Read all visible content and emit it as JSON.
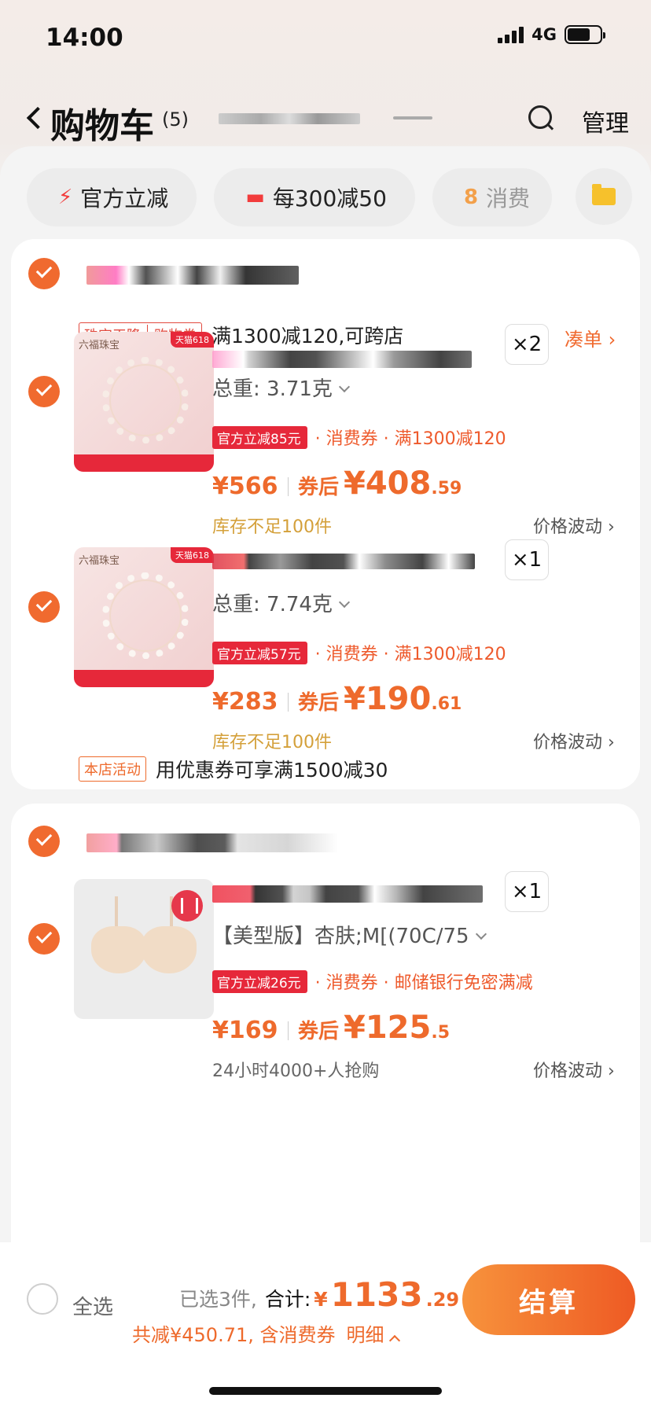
{
  "status": {
    "time": "14:00",
    "network": "4G"
  },
  "nav": {
    "title": "购物车",
    "count": "(5)",
    "manage": "管理"
  },
  "filters": [
    {
      "icon": "⚡",
      "label": "官方立减"
    },
    {
      "icon": "▬",
      "label": "每300减50"
    },
    {
      "icon": "8",
      "label": "消费"
    }
  ],
  "store1": {
    "promo_tag_a": "珠宝天降",
    "promo_tag_b": "购物券",
    "promo_text": "满1300减120,可跨店",
    "promo_link": "凑单 ›",
    "items": [
      {
        "qty": "×2",
        "thumb_brand": "六福珠宝",
        "thumb_badge": "天猫618",
        "spec": "总重: 3.71克",
        "deal_tag": "官方立减85元",
        "deal_text": "· 消费券 · 满1300减120",
        "price": "¥566",
        "after_label": "券后",
        "after_big": "¥408",
        "after_small": ".59",
        "note": "库存不足100件",
        "fluct": "价格波动 ›"
      },
      {
        "qty": "×1",
        "thumb_brand": "六福珠宝",
        "thumb_badge": "天猫618",
        "spec": "总重: 7.74克",
        "deal_tag": "官方立减57元",
        "deal_text": "· 消费券 · 满1300减120",
        "price": "¥283",
        "after_label": "券后",
        "after_big": "¥190",
        "after_small": ".61",
        "note": "库存不足100件",
        "fluct": "价格波动 ›"
      }
    ],
    "activity_tag": "本店活动",
    "activity_text": "用优惠券可享满1500减30"
  },
  "store2": {
    "items": [
      {
        "qty": "×1",
        "spec": "【美型版】杏肤;M[(70C/75",
        "deal_tag": "官方立减26元",
        "deal_text": "· 消费券 · 邮储银行免密满减",
        "price": "¥169",
        "after_label": "券后",
        "after_big": "¥125",
        "after_small": ".5",
        "note": "24小时4000+人抢购",
        "fluct": "价格波动 ›"
      }
    ]
  },
  "footer": {
    "select_all": "全选",
    "selected": "已选3件,",
    "total_label": "合计:",
    "total_yen": "¥",
    "total_big": "1133",
    "total_small": ".29",
    "saved": "共减¥450.71, 含消费券",
    "detail": "明细",
    "checkout": "结算"
  },
  "colors": {
    "accent": "#ee6a2c",
    "check": "#f06a2f",
    "red": "#e6283a",
    "stock": "#d4a03a"
  }
}
